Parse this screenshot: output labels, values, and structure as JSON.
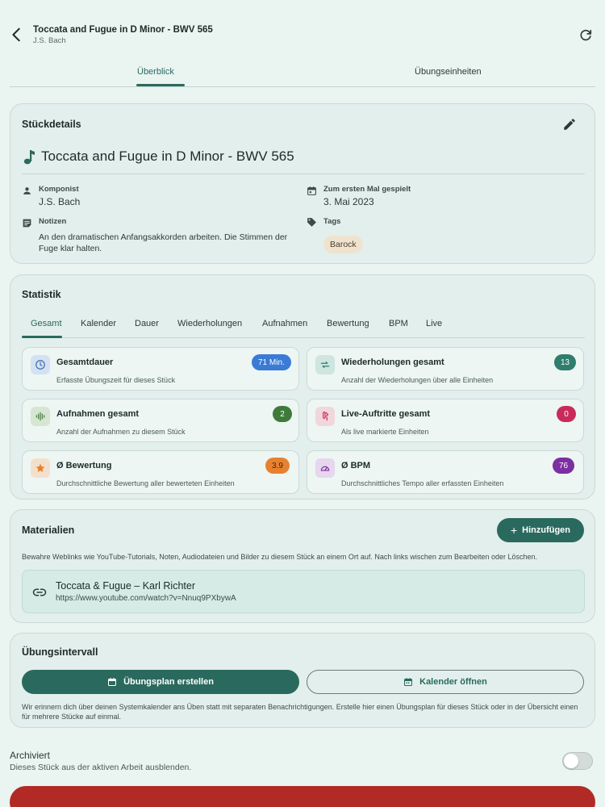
{
  "header": {
    "title": "Toccata and Fugue in D Minor - BWV 565",
    "subtitle": "J.S. Bach"
  },
  "main_tabs": [
    {
      "label": "Überblick",
      "active": true
    },
    {
      "label": "Übungseinheiten",
      "active": false
    }
  ],
  "details": {
    "card_title": "Stückdetails",
    "piece_title": "Toccata and Fugue in D Minor - BWV 565",
    "composer_label": "Komponist",
    "composer_value": "J.S. Bach",
    "first_played_label": "Zum ersten Mal gespielt",
    "first_played_value": "3. Mai 2023",
    "notes_label": "Notizen",
    "notes_value": "An den dramatischen Anfangsakkorden arbeiten. Die Stimmen der Fuge klar halten.",
    "tags_label": "Tags",
    "tags": [
      "Barock"
    ]
  },
  "stats": {
    "card_title": "Statistik",
    "tabs": [
      "Gesamt",
      "Kalender",
      "Dauer",
      "Wiederholungen",
      "Aufnahmen",
      "Bewertung",
      "BPM",
      "Live"
    ],
    "active_tab": "Gesamt",
    "items": [
      {
        "title": "Gesamtdauer",
        "desc": "Erfasste Übungszeit für dieses Stück",
        "badge": "71 Min.",
        "badge_color": "#3a7bd5",
        "icon": "clock-icon"
      },
      {
        "title": "Wiederholungen gesamt",
        "desc": "Anzahl der Wiederholungen über alle Einheiten",
        "badge": "13",
        "badge_color": "#2f7d6d",
        "icon": "repeat-icon"
      },
      {
        "title": "Aufnahmen gesamt",
        "desc": "Anzahl der Aufnahmen zu diesem Stück",
        "badge": "2",
        "badge_color": "#3f7a3a",
        "icon": "waveform-icon"
      },
      {
        "title": "Live-Auftritte gesamt",
        "desc": "Als live markierte Einheiten",
        "badge": "0",
        "badge_color": "#c92a5a",
        "icon": "microphone-icon"
      },
      {
        "title": "Ø Bewertung",
        "desc": "Durchschnittliche Bewertung aller bewerteten Einheiten",
        "badge": "3.9",
        "badge_color": "#e8812f",
        "badge_text_color": "#3a2a14",
        "icon": "star-icon"
      },
      {
        "title": "Ø BPM",
        "desc": "Durchschnittliches Tempo aller erfassten Einheiten",
        "badge": "76",
        "badge_color": "#7b2fa0",
        "icon": "speedometer-icon"
      }
    ]
  },
  "materials": {
    "card_title": "Materialien",
    "add_label": "Hinzufügen",
    "description": "Bewahre Weblinks wie YouTube-Tutorials, Noten, Audiodateien und Bilder zu diesem Stück an einem Ort auf. Nach links wischen zum Bearbeiten oder Löschen.",
    "items": [
      {
        "title": "Toccata & Fugue – Karl Richter",
        "url": "https://www.youtube.com/watch?v=Nnuq9PXbywA"
      }
    ]
  },
  "interval": {
    "card_title": "Übungsintervall",
    "plan_label": "Übungsplan erstellen",
    "calendar_label": "Kalender öffnen",
    "description": "Wir erinnern dich über deinen Systemkalender ans Üben statt mit separaten Benachrichtigungen. Erstelle hier einen Übungsplan für dieses Stück oder in der Übersicht einen für mehrere Stücke auf einmal."
  },
  "archive": {
    "title": "Archiviert",
    "description": "Dieses Stück aus der aktiven Arbeit ausblenden.",
    "enabled": false
  },
  "colors": {
    "accent": "#2a6a5e",
    "background": "#eaf4f1",
    "danger": "#b22a25"
  }
}
